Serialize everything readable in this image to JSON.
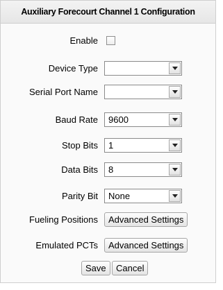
{
  "panel": {
    "title": "Auxiliary Forecourt Channel 1 Configuration"
  },
  "form": {
    "enable": {
      "label": "Enable",
      "checked": false
    },
    "device_type": {
      "label": "Device Type",
      "value": ""
    },
    "serial_port_name": {
      "label": "Serial Port Name",
      "value": ""
    },
    "baud_rate": {
      "label": "Baud Rate",
      "value": "9600"
    },
    "stop_bits": {
      "label": "Stop Bits",
      "value": "1"
    },
    "data_bits": {
      "label": "Data Bits",
      "value": "8"
    },
    "parity_bit": {
      "label": "Parity Bit",
      "value": "None"
    },
    "fueling_positions": {
      "label": "Fueling Positions",
      "button": "Advanced Settings"
    },
    "emulated_pcts": {
      "label": "Emulated PCTs",
      "button": "Advanced Settings"
    }
  },
  "actions": {
    "save": "Save",
    "cancel": "Cancel"
  },
  "icons": {
    "dropdown": "chevron-down-icon"
  }
}
